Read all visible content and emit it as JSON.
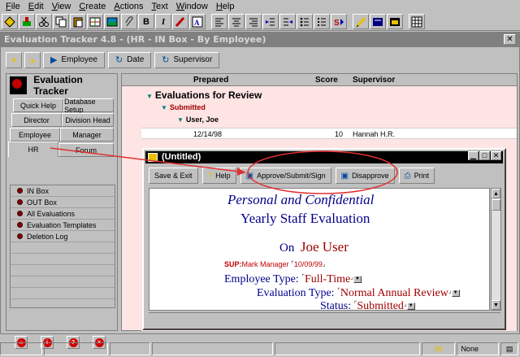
{
  "menu": [
    "File",
    "Edit",
    "View",
    "Create",
    "Actions",
    "Text",
    "Window",
    "Help"
  ],
  "toolbar_icons": [
    "smart-icon",
    "paint-icon",
    "scissors-icon",
    "copy-icon",
    "paste-icon",
    "table-icon",
    "image-icon",
    "attach-icon",
    "bold-icon",
    "italic-icon",
    "highlight-icon",
    "font-icon",
    "align-left-icon",
    "align-center-icon",
    "align-right-icon",
    "indent-icon",
    "outdent-icon",
    "bullet-icon",
    "number-icon",
    "style-icon",
    "pen-icon",
    "book-icon",
    "calendar-icon",
    "table-grid-icon"
  ],
  "app": {
    "title": "Evaluation Tracker 4.8 - (HR - IN Box - By Employee)",
    "nav_buttons": {
      "employee": "Employee",
      "date": "Date",
      "supervisor": "Supervisor"
    }
  },
  "left_panel": {
    "title": "Evaluation Tracker",
    "tabs": {
      "quick_help": "Quick Help",
      "database_setup": "Database Setup",
      "director": "Director",
      "division_head": "Division Head",
      "employee": "Employee",
      "manager": "Manager",
      "hr": "HR",
      "forum": "Forum"
    },
    "nav_items": [
      "IN Box",
      "OUT Box",
      "All Evaluations",
      "Evaluation Templates",
      "Deletion Log"
    ]
  },
  "view": {
    "columns": {
      "prepared": "Prepared",
      "score": "Score",
      "supervisor": "Supervisor"
    },
    "category": "Evaluations for Review",
    "status_group": "Submitted",
    "employee_group": "User, Joe",
    "row": {
      "prepared": "12/14/98",
      "score": "10",
      "supervisor": "Hannah H.R."
    }
  },
  "doc": {
    "title": "(Untitled)",
    "buttons": {
      "save_exit": "Save & Exit",
      "help": "Help",
      "approve": "Approve/Submit/Sign",
      "disapprove": "Disapprove",
      "print": "Print"
    },
    "heading1": "Personal and Confidential",
    "heading2": "Yearly Staff Evaluation",
    "on_label": "On",
    "employee_name": "Joe User",
    "sup_label": "SUP:",
    "sup_name": "Mark Manager",
    "sup_date": "10/09/99",
    "employee_type_label": "Employee Type:",
    "employee_type_value": "Full-Time",
    "eval_type_label": "Evaluation Type:",
    "eval_type_value": "Normal Annual Review",
    "status_label": "Status:",
    "status_value": "Submitted"
  },
  "statusbar": {
    "none_label": "None"
  },
  "colors": {
    "accent_red": "#c00000",
    "highlight_bg": "#ffe4e4",
    "doc_blue": "#00008b",
    "annotation": "#e03030"
  }
}
